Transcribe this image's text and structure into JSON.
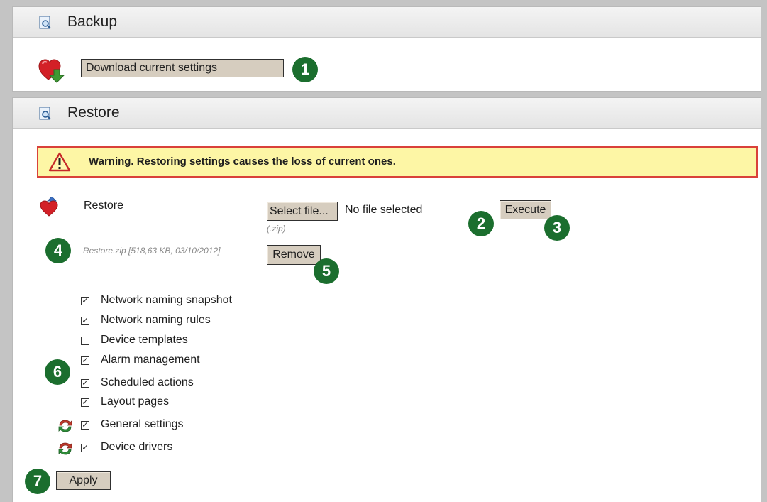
{
  "backup": {
    "title": "Backup",
    "download_label": "Download current settings"
  },
  "restore": {
    "title": "Restore",
    "warning_text": "Warning. Restoring settings causes the loss of current ones.",
    "restore_label": "Restore",
    "select_file_label": "Select file...",
    "no_file_text": "No file selected",
    "file_ext_hint": "(.zip)",
    "execute_label": "Execute",
    "file_info": "Restore.zip [518,63 KB, 03/10/2012]",
    "remove_label": "Remove",
    "options": [
      {
        "label": "Network naming snapshot",
        "checked": true
      },
      {
        "label": "Network naming rules",
        "checked": true
      },
      {
        "label": "Device templates",
        "checked": false
      },
      {
        "label": "Alarm management",
        "checked": true
      },
      {
        "label": "Scheduled actions",
        "checked": true
      },
      {
        "label": "Layout pages",
        "checked": true
      },
      {
        "label": "General settings",
        "checked": true,
        "refresh_icon": true
      },
      {
        "label": "Device drivers",
        "checked": true,
        "refresh_icon": true
      }
    ],
    "apply_label": "Apply"
  },
  "callouts": [
    "1",
    "2",
    "3",
    "4",
    "5",
    "6",
    "7"
  ],
  "colors": {
    "badge": "#1b6e2e",
    "button_bg": "#d6cdbf",
    "warning_bg": "#fdf6a5",
    "warning_border": "#d9413a"
  }
}
